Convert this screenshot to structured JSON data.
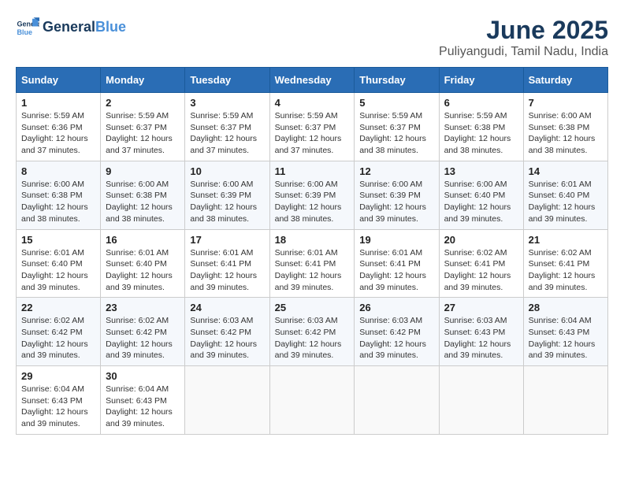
{
  "header": {
    "logo_line1": "General",
    "logo_line2": "Blue",
    "title": "June 2025",
    "subtitle": "Puliyangudi, Tamil Nadu, India"
  },
  "weekdays": [
    "Sunday",
    "Monday",
    "Tuesday",
    "Wednesday",
    "Thursday",
    "Friday",
    "Saturday"
  ],
  "weeks": [
    [
      {
        "day": "1",
        "sunrise": "Sunrise: 5:59 AM",
        "sunset": "Sunset: 6:36 PM",
        "daylight": "Daylight: 12 hours and 37 minutes."
      },
      {
        "day": "2",
        "sunrise": "Sunrise: 5:59 AM",
        "sunset": "Sunset: 6:37 PM",
        "daylight": "Daylight: 12 hours and 37 minutes."
      },
      {
        "day": "3",
        "sunrise": "Sunrise: 5:59 AM",
        "sunset": "Sunset: 6:37 PM",
        "daylight": "Daylight: 12 hours and 37 minutes."
      },
      {
        "day": "4",
        "sunrise": "Sunrise: 5:59 AM",
        "sunset": "Sunset: 6:37 PM",
        "daylight": "Daylight: 12 hours and 37 minutes."
      },
      {
        "day": "5",
        "sunrise": "Sunrise: 5:59 AM",
        "sunset": "Sunset: 6:37 PM",
        "daylight": "Daylight: 12 hours and 38 minutes."
      },
      {
        "day": "6",
        "sunrise": "Sunrise: 5:59 AM",
        "sunset": "Sunset: 6:38 PM",
        "daylight": "Daylight: 12 hours and 38 minutes."
      },
      {
        "day": "7",
        "sunrise": "Sunrise: 6:00 AM",
        "sunset": "Sunset: 6:38 PM",
        "daylight": "Daylight: 12 hours and 38 minutes."
      }
    ],
    [
      {
        "day": "8",
        "sunrise": "Sunrise: 6:00 AM",
        "sunset": "Sunset: 6:38 PM",
        "daylight": "Daylight: 12 hours and 38 minutes."
      },
      {
        "day": "9",
        "sunrise": "Sunrise: 6:00 AM",
        "sunset": "Sunset: 6:38 PM",
        "daylight": "Daylight: 12 hours and 38 minutes."
      },
      {
        "day": "10",
        "sunrise": "Sunrise: 6:00 AM",
        "sunset": "Sunset: 6:39 PM",
        "daylight": "Daylight: 12 hours and 38 minutes."
      },
      {
        "day": "11",
        "sunrise": "Sunrise: 6:00 AM",
        "sunset": "Sunset: 6:39 PM",
        "daylight": "Daylight: 12 hours and 38 minutes."
      },
      {
        "day": "12",
        "sunrise": "Sunrise: 6:00 AM",
        "sunset": "Sunset: 6:39 PM",
        "daylight": "Daylight: 12 hours and 39 minutes."
      },
      {
        "day": "13",
        "sunrise": "Sunrise: 6:00 AM",
        "sunset": "Sunset: 6:40 PM",
        "daylight": "Daylight: 12 hours and 39 minutes."
      },
      {
        "day": "14",
        "sunrise": "Sunrise: 6:01 AM",
        "sunset": "Sunset: 6:40 PM",
        "daylight": "Daylight: 12 hours and 39 minutes."
      }
    ],
    [
      {
        "day": "15",
        "sunrise": "Sunrise: 6:01 AM",
        "sunset": "Sunset: 6:40 PM",
        "daylight": "Daylight: 12 hours and 39 minutes."
      },
      {
        "day": "16",
        "sunrise": "Sunrise: 6:01 AM",
        "sunset": "Sunset: 6:40 PM",
        "daylight": "Daylight: 12 hours and 39 minutes."
      },
      {
        "day": "17",
        "sunrise": "Sunrise: 6:01 AM",
        "sunset": "Sunset: 6:41 PM",
        "daylight": "Daylight: 12 hours and 39 minutes."
      },
      {
        "day": "18",
        "sunrise": "Sunrise: 6:01 AM",
        "sunset": "Sunset: 6:41 PM",
        "daylight": "Daylight: 12 hours and 39 minutes."
      },
      {
        "day": "19",
        "sunrise": "Sunrise: 6:01 AM",
        "sunset": "Sunset: 6:41 PM",
        "daylight": "Daylight: 12 hours and 39 minutes."
      },
      {
        "day": "20",
        "sunrise": "Sunrise: 6:02 AM",
        "sunset": "Sunset: 6:41 PM",
        "daylight": "Daylight: 12 hours and 39 minutes."
      },
      {
        "day": "21",
        "sunrise": "Sunrise: 6:02 AM",
        "sunset": "Sunset: 6:41 PM",
        "daylight": "Daylight: 12 hours and 39 minutes."
      }
    ],
    [
      {
        "day": "22",
        "sunrise": "Sunrise: 6:02 AM",
        "sunset": "Sunset: 6:42 PM",
        "daylight": "Daylight: 12 hours and 39 minutes."
      },
      {
        "day": "23",
        "sunrise": "Sunrise: 6:02 AM",
        "sunset": "Sunset: 6:42 PM",
        "daylight": "Daylight: 12 hours and 39 minutes."
      },
      {
        "day": "24",
        "sunrise": "Sunrise: 6:03 AM",
        "sunset": "Sunset: 6:42 PM",
        "daylight": "Daylight: 12 hours and 39 minutes."
      },
      {
        "day": "25",
        "sunrise": "Sunrise: 6:03 AM",
        "sunset": "Sunset: 6:42 PM",
        "daylight": "Daylight: 12 hours and 39 minutes."
      },
      {
        "day": "26",
        "sunrise": "Sunrise: 6:03 AM",
        "sunset": "Sunset: 6:42 PM",
        "daylight": "Daylight: 12 hours and 39 minutes."
      },
      {
        "day": "27",
        "sunrise": "Sunrise: 6:03 AM",
        "sunset": "Sunset: 6:43 PM",
        "daylight": "Daylight: 12 hours and 39 minutes."
      },
      {
        "day": "28",
        "sunrise": "Sunrise: 6:04 AM",
        "sunset": "Sunset: 6:43 PM",
        "daylight": "Daylight: 12 hours and 39 minutes."
      }
    ],
    [
      {
        "day": "29",
        "sunrise": "Sunrise: 6:04 AM",
        "sunset": "Sunset: 6:43 PM",
        "daylight": "Daylight: 12 hours and 39 minutes."
      },
      {
        "day": "30",
        "sunrise": "Sunrise: 6:04 AM",
        "sunset": "Sunset: 6:43 PM",
        "daylight": "Daylight: 12 hours and 39 minutes."
      },
      null,
      null,
      null,
      null,
      null
    ]
  ]
}
